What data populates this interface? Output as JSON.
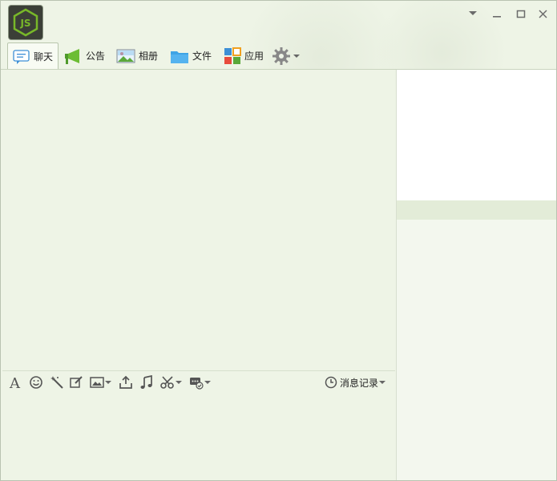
{
  "window": {
    "controls": [
      {
        "icon": "dropdown-arrow-icon"
      },
      {
        "icon": "minimize-icon"
      },
      {
        "icon": "maximize-icon"
      },
      {
        "icon": "close-icon"
      }
    ]
  },
  "avatar": {
    "logo_text": "JS",
    "logo_color": "#78b829"
  },
  "tabs": [
    {
      "label": "聊天",
      "icon": "chat-bubble-icon",
      "active": true
    },
    {
      "label": "公告",
      "icon": "megaphone-icon",
      "active": false
    },
    {
      "label": "相册",
      "icon": "photo-icon",
      "active": false
    },
    {
      "label": "文件",
      "icon": "folder-icon",
      "active": false
    },
    {
      "label": "应用",
      "icon": "apps-grid-icon",
      "active": false
    }
  ],
  "settings": {
    "icon": "gear-icon"
  },
  "toolbar": {
    "items": [
      {
        "icon": "font-icon"
      },
      {
        "icon": "emoji-icon"
      },
      {
        "icon": "magic-wand-icon"
      },
      {
        "icon": "edit-icon"
      },
      {
        "icon": "image-icon"
      },
      {
        "icon": "upload-icon"
      },
      {
        "icon": "music-icon"
      },
      {
        "icon": "scissors-icon"
      },
      {
        "icon": "screen-record-icon"
      }
    ],
    "history_label": "消息记录",
    "history_icon": "clock-icon"
  },
  "colors": {
    "chat_bg": "#eef4e6",
    "sidebar_band": "#e3ecd8",
    "icon_gray": "#555555"
  }
}
